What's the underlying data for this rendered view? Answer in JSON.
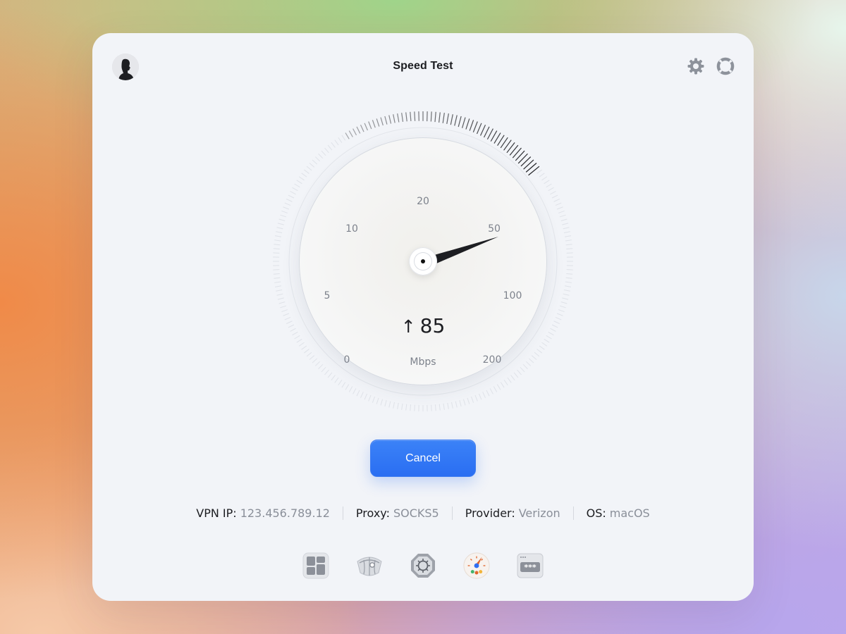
{
  "window": {
    "title": "Speed Test",
    "avatar_icon": "user-avatar-icon",
    "settings_icon": "gear-icon",
    "help_icon": "lifebuoy-icon"
  },
  "gauge": {
    "scale_labels": [
      "0",
      "5",
      "10",
      "20",
      "50",
      "100",
      "200"
    ],
    "direction_glyph": "↑",
    "value": "85",
    "unit": "Mbps"
  },
  "actions": {
    "cancel_label": "Cancel"
  },
  "connection_info": [
    {
      "key": "VPN IP:",
      "value": "123.456.789.12"
    },
    {
      "key": "Proxy:",
      "value": "SOCKS5"
    },
    {
      "key": "Provider:",
      "value": "Verizon"
    },
    {
      "key": "OS:",
      "value": "macOS"
    }
  ],
  "dock": {
    "items": [
      "dashboard-icon",
      "globe-map-icon",
      "virus-shield-icon",
      "speedometer-icon",
      "password-icon"
    ],
    "active": "speedometer-icon"
  },
  "colors": {
    "accent": "#2a6ef2",
    "window_bg": "#f2f4f8",
    "text_primary": "#1c1d21",
    "text_secondary": "#8a8f99"
  }
}
